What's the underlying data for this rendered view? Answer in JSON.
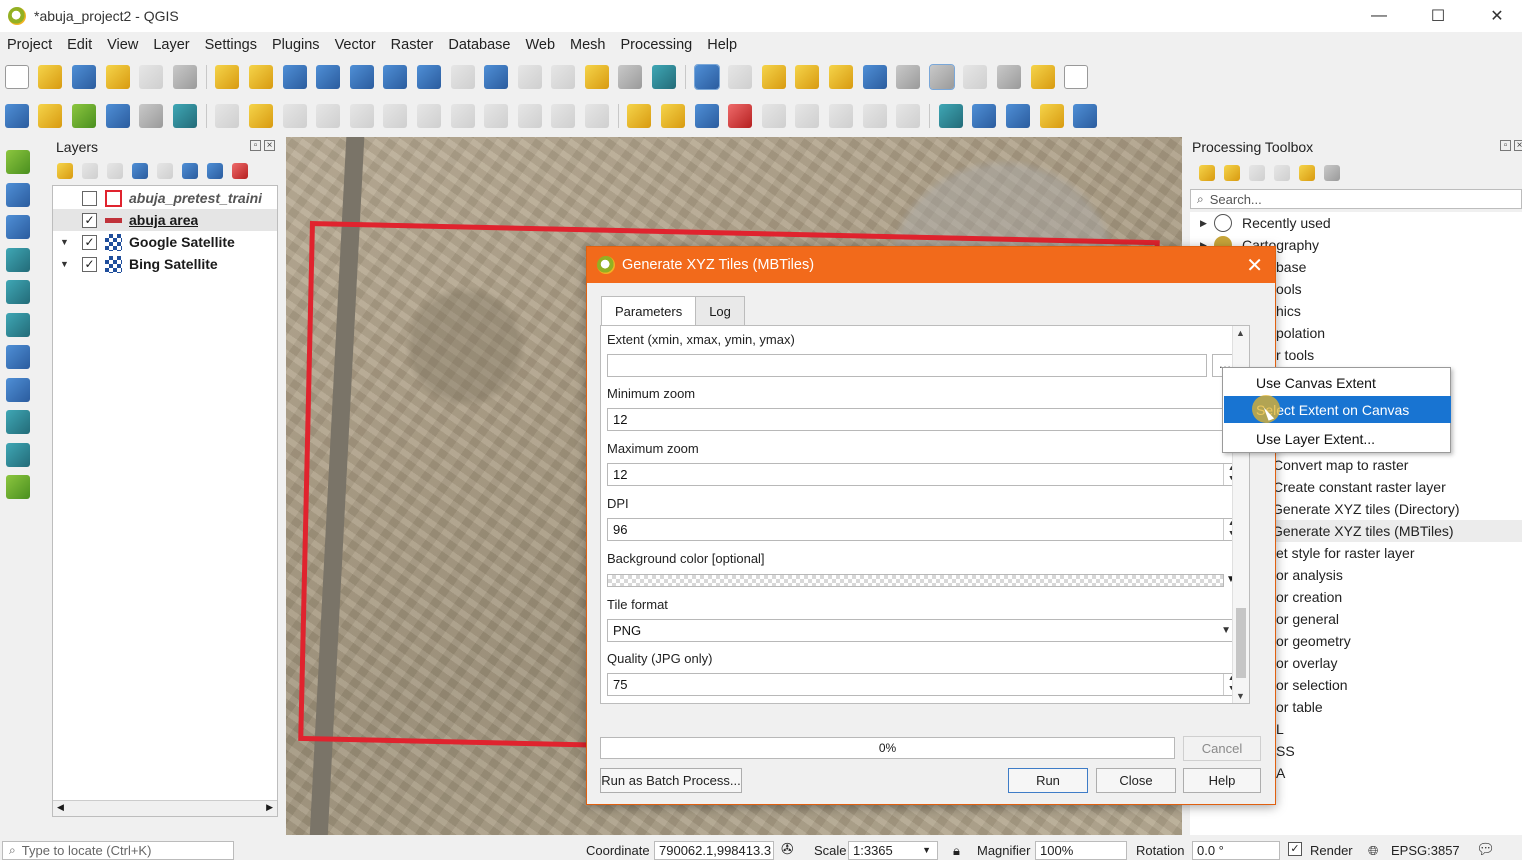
{
  "window": {
    "title": "*abuja_project2 - QGIS"
  },
  "menu": [
    "Project",
    "Edit",
    "View",
    "Layer",
    "Settings",
    "Plugins",
    "Vector",
    "Raster",
    "Database",
    "Web",
    "Mesh",
    "Processing",
    "Help"
  ],
  "layers_panel": {
    "title": "Layers",
    "items": [
      {
        "name": "abuja_pretest_traini",
        "checked": false,
        "expand": "",
        "style": "italic-polygon"
      },
      {
        "name": "abuja area",
        "checked": true,
        "expand": "",
        "style": "line"
      },
      {
        "name": "Google Satellite",
        "checked": true,
        "expand": "▼",
        "style": "raster"
      },
      {
        "name": "Bing Satellite",
        "checked": true,
        "expand": "▼",
        "style": "raster"
      }
    ]
  },
  "toolbox": {
    "title": "Processing Toolbox",
    "search_placeholder": "Search...",
    "items": [
      "Recently used",
      "Cartography",
      "base",
      "ools",
      "hics",
      "polation",
      "r tools",
      "",
      "",
      "",
      "",
      "Convert map to raster",
      "Create constant raster layer",
      "Generate XYZ tiles (Directory)",
      "Generate XYZ tiles (MBTiles)",
      "et style for raster layer",
      "or analysis",
      "or creation",
      "or general",
      "or geometry",
      "or overlay",
      "or selection",
      "or table",
      "L",
      "SS",
      "A"
    ]
  },
  "dialog": {
    "title": "Generate XYZ Tiles (MBTiles)",
    "tabs": [
      "Parameters",
      "Log"
    ],
    "fields": {
      "extent_label": "Extent (xmin, xmax, ymin, ymax)",
      "extent_value": "",
      "minzoom_label": "Minimum zoom",
      "minzoom_value": "12",
      "maxzoom_label": "Maximum zoom",
      "maxzoom_value": "12",
      "dpi_label": "DPI",
      "dpi_value": "96",
      "bgcolor_label": "Background color [optional]",
      "format_label": "Tile format",
      "format_value": "PNG",
      "quality_label": "Quality (JPG only)",
      "quality_value": "75"
    },
    "progress": "0%",
    "buttons": {
      "cancel": "Cancel",
      "batch": "Run as Batch Process...",
      "run": "Run",
      "close": "Close",
      "help": "Help"
    }
  },
  "context_menu": {
    "items": [
      "Use Canvas Extent",
      "Select Extent on Canvas",
      "Use Layer Extent..."
    ],
    "selected_index": 1
  },
  "statusbar": {
    "locate_placeholder": "Type to locate (Ctrl+K)",
    "coordinate_label": "Coordinate",
    "coordinate_value": "790062.1,998413.3",
    "scale_label": "Scale",
    "scale_value": "1:3365",
    "magnifier_label": "Magnifier",
    "magnifier_value": "100%",
    "rotation_label": "Rotation",
    "rotation_value": "0.0 °",
    "render_label": "Render",
    "crs": "EPSG:3857"
  },
  "colors": {
    "accent": "#f26a1b",
    "selection": "#1874d2",
    "aoi": "#e0232e"
  }
}
